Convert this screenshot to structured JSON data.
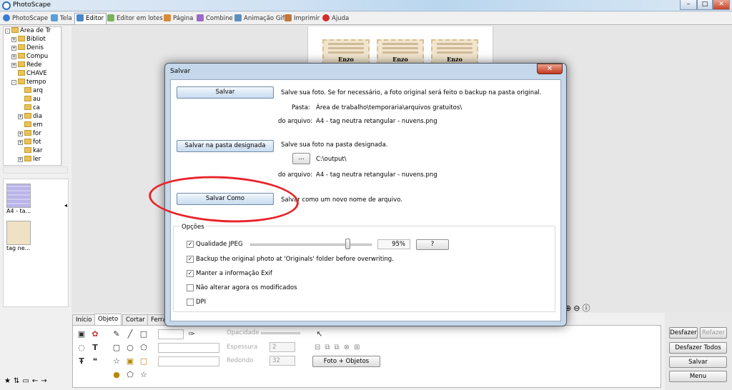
{
  "app": {
    "title": "PhotoScape"
  },
  "window_controls": {
    "minimize": "–",
    "maximize": "□",
    "close": "✕"
  },
  "tabs": [
    {
      "label": "PhotoScape",
      "icon": "photoscape-icon"
    },
    {
      "label": "Tela",
      "icon": "viewer-icon"
    },
    {
      "label": "Editor",
      "icon": "editor-icon",
      "active": true
    },
    {
      "label": "Editor em lotes",
      "icon": "batch-editor-icon"
    },
    {
      "label": "Página",
      "icon": "page-icon"
    },
    {
      "label": "Combine",
      "icon": "combine-icon"
    },
    {
      "label": "Animação Gif",
      "icon": "animated-gif-icon"
    },
    {
      "label": "Imprimir",
      "icon": "print-icon"
    },
    {
      "label": "Ajuda",
      "icon": "help-icon"
    }
  ],
  "tree": [
    {
      "label": "Área de Tr",
      "level": 0,
      "expander": "-"
    },
    {
      "label": "Bibliot",
      "level": 1,
      "expander": "+"
    },
    {
      "label": "Denis",
      "level": 1,
      "expander": "+"
    },
    {
      "label": "Compu",
      "level": 1,
      "expander": "+"
    },
    {
      "label": "Rede",
      "level": 1,
      "expander": "+"
    },
    {
      "label": "CHAVE",
      "level": 1,
      "expander": ""
    },
    {
      "label": "tempo",
      "level": 1,
      "expander": "-"
    },
    {
      "label": "arq",
      "level": 2,
      "expander": ""
    },
    {
      "label": "au",
      "level": 2,
      "expander": ""
    },
    {
      "label": "ca",
      "level": 2,
      "expander": ""
    },
    {
      "label": "dia",
      "level": 2,
      "expander": "+"
    },
    {
      "label": "em",
      "level": 2,
      "expander": ""
    },
    {
      "label": "for",
      "level": 2,
      "expander": "+"
    },
    {
      "label": "fot",
      "level": 2,
      "expander": "+"
    },
    {
      "label": "kar",
      "level": 2,
      "expander": ""
    },
    {
      "label": "ler",
      "level": 2,
      "expander": "+"
    }
  ],
  "thumbnails": [
    {
      "label": "A4 - ta...",
      "color": "#b9b4e8"
    },
    {
      "label": "tag ne...",
      "color": "#efe1c3"
    }
  ],
  "canvas": {
    "tag_name": "Enzo",
    "tag_count": 3
  },
  "bottom_tabs": [
    "Início",
    "Objeto",
    "Cortar",
    "Ferramentas"
  ],
  "bottom_tools": {
    "opacity_label": "Opacidade",
    "thickness_label": "Espessura",
    "thickness_value": "2",
    "rounded_label": "Redondo",
    "rounded_value": "32",
    "photo_objects_button": "Foto + Objetos"
  },
  "right_buttons": {
    "undo": "Desfazer",
    "redo": "Refazer",
    "undo_all": "Desfazer Todos",
    "save": "Salvar",
    "menu": "Menu"
  },
  "dialog": {
    "title": "Salvar",
    "close": "✕",
    "save_button": "Salvar",
    "save_desc": "Salve sua foto. Se for necessário, a foto original será feito o backup na pasta original.",
    "folder_label": "Pasta:",
    "folder_value": "Área de trabalho\\temporaria\\arquivos gratuitos\\",
    "filename_label": "do arquivo:",
    "filename_value": "A4 - tag neutra retangular - nuvens.png",
    "save_designated_button": "Salvar na pasta designada",
    "save_designated_desc": "Salve sua foto na pasta designada.",
    "browse_button": "...",
    "output_path": "C:\\output\\",
    "filename_label_2": "do arquivo:",
    "filename_value_2": "A4 - tag neutra retangular - nuvens.png",
    "save_as_button": "Salvar Como",
    "save_as_desc": "Salvar como um novo nome de arquivo.",
    "options": {
      "legend": "Opções",
      "jpeg_quality_label": "Qualidade JPEG",
      "jpeg_quality_value": "95%",
      "jpeg_quality_fraction": 0.95,
      "help_button": "?",
      "checkboxes": [
        {
          "label": "Qualidade JPEG",
          "checked": true
        },
        {
          "label": "Backup the original photo at 'Originals' folder before overwriting.",
          "checked": true
        },
        {
          "label": "Manter a informação Exif",
          "checked": true
        },
        {
          "label": "Não alterar agora os modificados",
          "checked": false
        },
        {
          "label": "DPI",
          "checked": false
        }
      ]
    }
  },
  "colors": {
    "highlight_circle": "#e8242b",
    "dialog_frame": "#c5d7ea",
    "button_blue": "#c9dcef"
  }
}
